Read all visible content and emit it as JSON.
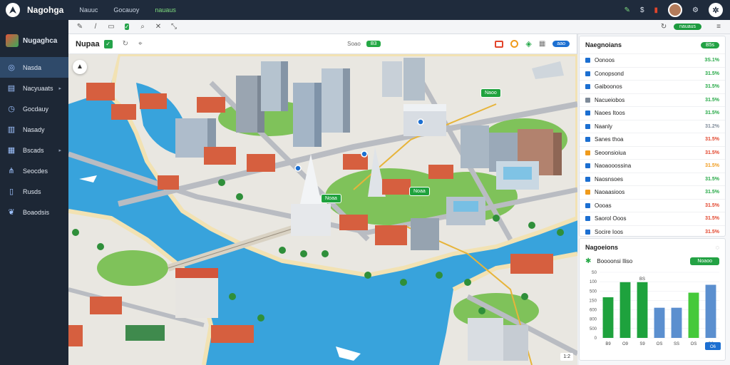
{
  "app": {
    "title": "Nagohga"
  },
  "topnav": [
    "Nauuc",
    "Gocauoy",
    "nauaus"
  ],
  "topbar_icons": [
    "pin-icon",
    "dollar-icon",
    "battery-icon",
    "avatar",
    "help-icon"
  ],
  "sidebar": {
    "brand": "Nugaghca",
    "items": [
      {
        "label": "Nasda",
        "icon": "globe-icon",
        "active": true
      },
      {
        "label": "Nacyuaats",
        "icon": "layers-icon",
        "arrow": "▸"
      },
      {
        "label": "Gocdauy",
        "icon": "clock-icon"
      },
      {
        "label": "Nasady",
        "icon": "chart-icon"
      },
      {
        "label": "Bscads",
        "icon": "document-icon",
        "arrow": "▸"
      },
      {
        "label": "Seocdes",
        "icon": "share-icon"
      },
      {
        "label": "Rusds",
        "icon": "file-icon"
      },
      {
        "label": "Boaodsis",
        "icon": "leaf-icon"
      }
    ]
  },
  "tabbar": {
    "right_badge": "nauaus"
  },
  "map_toolbar": {
    "title": "Nupaa",
    "count_label": "Soao",
    "count_badge": "B3",
    "right_badge": "aao"
  },
  "map_markers": [
    "Naoo",
    "Noaa",
    "Noaa"
  ],
  "map_scale": "1:2",
  "list_panel": {
    "title": "Naegnoians",
    "badge": "B5s",
    "rows": [
      {
        "label": "Oonoos",
        "value": "3S.1%",
        "color": "#1c6fd1",
        "value_color": "#24a845"
      },
      {
        "label": "Conopsond",
        "value": "31.5%",
        "color": "#1c6fd1",
        "value_color": "#24a845"
      },
      {
        "label": "Gaiboonos",
        "value": "31.5%",
        "color": "#1c6fd1",
        "value_color": "#24a845"
      },
      {
        "label": "Nacueiobos",
        "value": "31.5%",
        "color": "#7f8b99",
        "value_color": "#24a845"
      },
      {
        "label": "Naoes Itoos",
        "value": "31.5%",
        "color": "#1c6fd1",
        "value_color": "#24a845"
      },
      {
        "label": "Naanly",
        "value": "31.2%",
        "color": "#1c6fd1",
        "value_color": "#7f8b99"
      },
      {
        "label": "Sanes thoa",
        "value": "31.5%",
        "color": "#1c6fd1",
        "value_color": "#e2452c"
      },
      {
        "label": "Seoonsioiua",
        "value": "31.5%",
        "color": "#f09b1c",
        "value_color": "#e2452c"
      },
      {
        "label": "Naoaooossina",
        "value": "31.5%",
        "color": "#1c6fd1",
        "value_color": "#f09b1c"
      },
      {
        "label": "Naosnsoes",
        "value": "31.5%",
        "color": "#1c6fd1",
        "value_color": "#24a845"
      },
      {
        "label": "Naoaasioos",
        "value": "31.5%",
        "color": "#f09b1c",
        "value_color": "#24a845"
      },
      {
        "label": "Oooas",
        "value": "31.5%",
        "color": "#1c6fd1",
        "value_color": "#e2452c"
      },
      {
        "label": "Saorol Ooos",
        "value": "31.5%",
        "color": "#1c6fd1",
        "value_color": "#e2452c"
      },
      {
        "label": "Socire Ioos",
        "value": "31.5%",
        "color": "#1c6fd1",
        "value_color": "#e2452c"
      }
    ]
  },
  "chart_panel": {
    "title": "Nagoeions",
    "legend_label": "Boooonsi Iliso",
    "badge": "Noaoo"
  },
  "chart_data": {
    "type": "bar",
    "title": "Nagoeions",
    "categories": [
      "B9",
      "O9",
      "S9",
      "OS",
      "SS",
      "OS",
      "O9"
    ],
    "y_ticks": [
      "S0",
      "100",
      "500",
      "1S0",
      "600",
      "800",
      "500",
      "0"
    ],
    "values": [
      0.62,
      0.85,
      0.85,
      0.46,
      0.46,
      0.69,
      0.81
    ],
    "top_labels": [
      "",
      "",
      "BS",
      "",
      "",
      "",
      ""
    ],
    "colors": [
      "#1ea23d",
      "#1ea23d",
      "#1ea23d",
      "#5b8fcf",
      "#5b8fcf",
      "#45c93a",
      "#5b8fcf"
    ],
    "footer_badge": "O6"
  }
}
